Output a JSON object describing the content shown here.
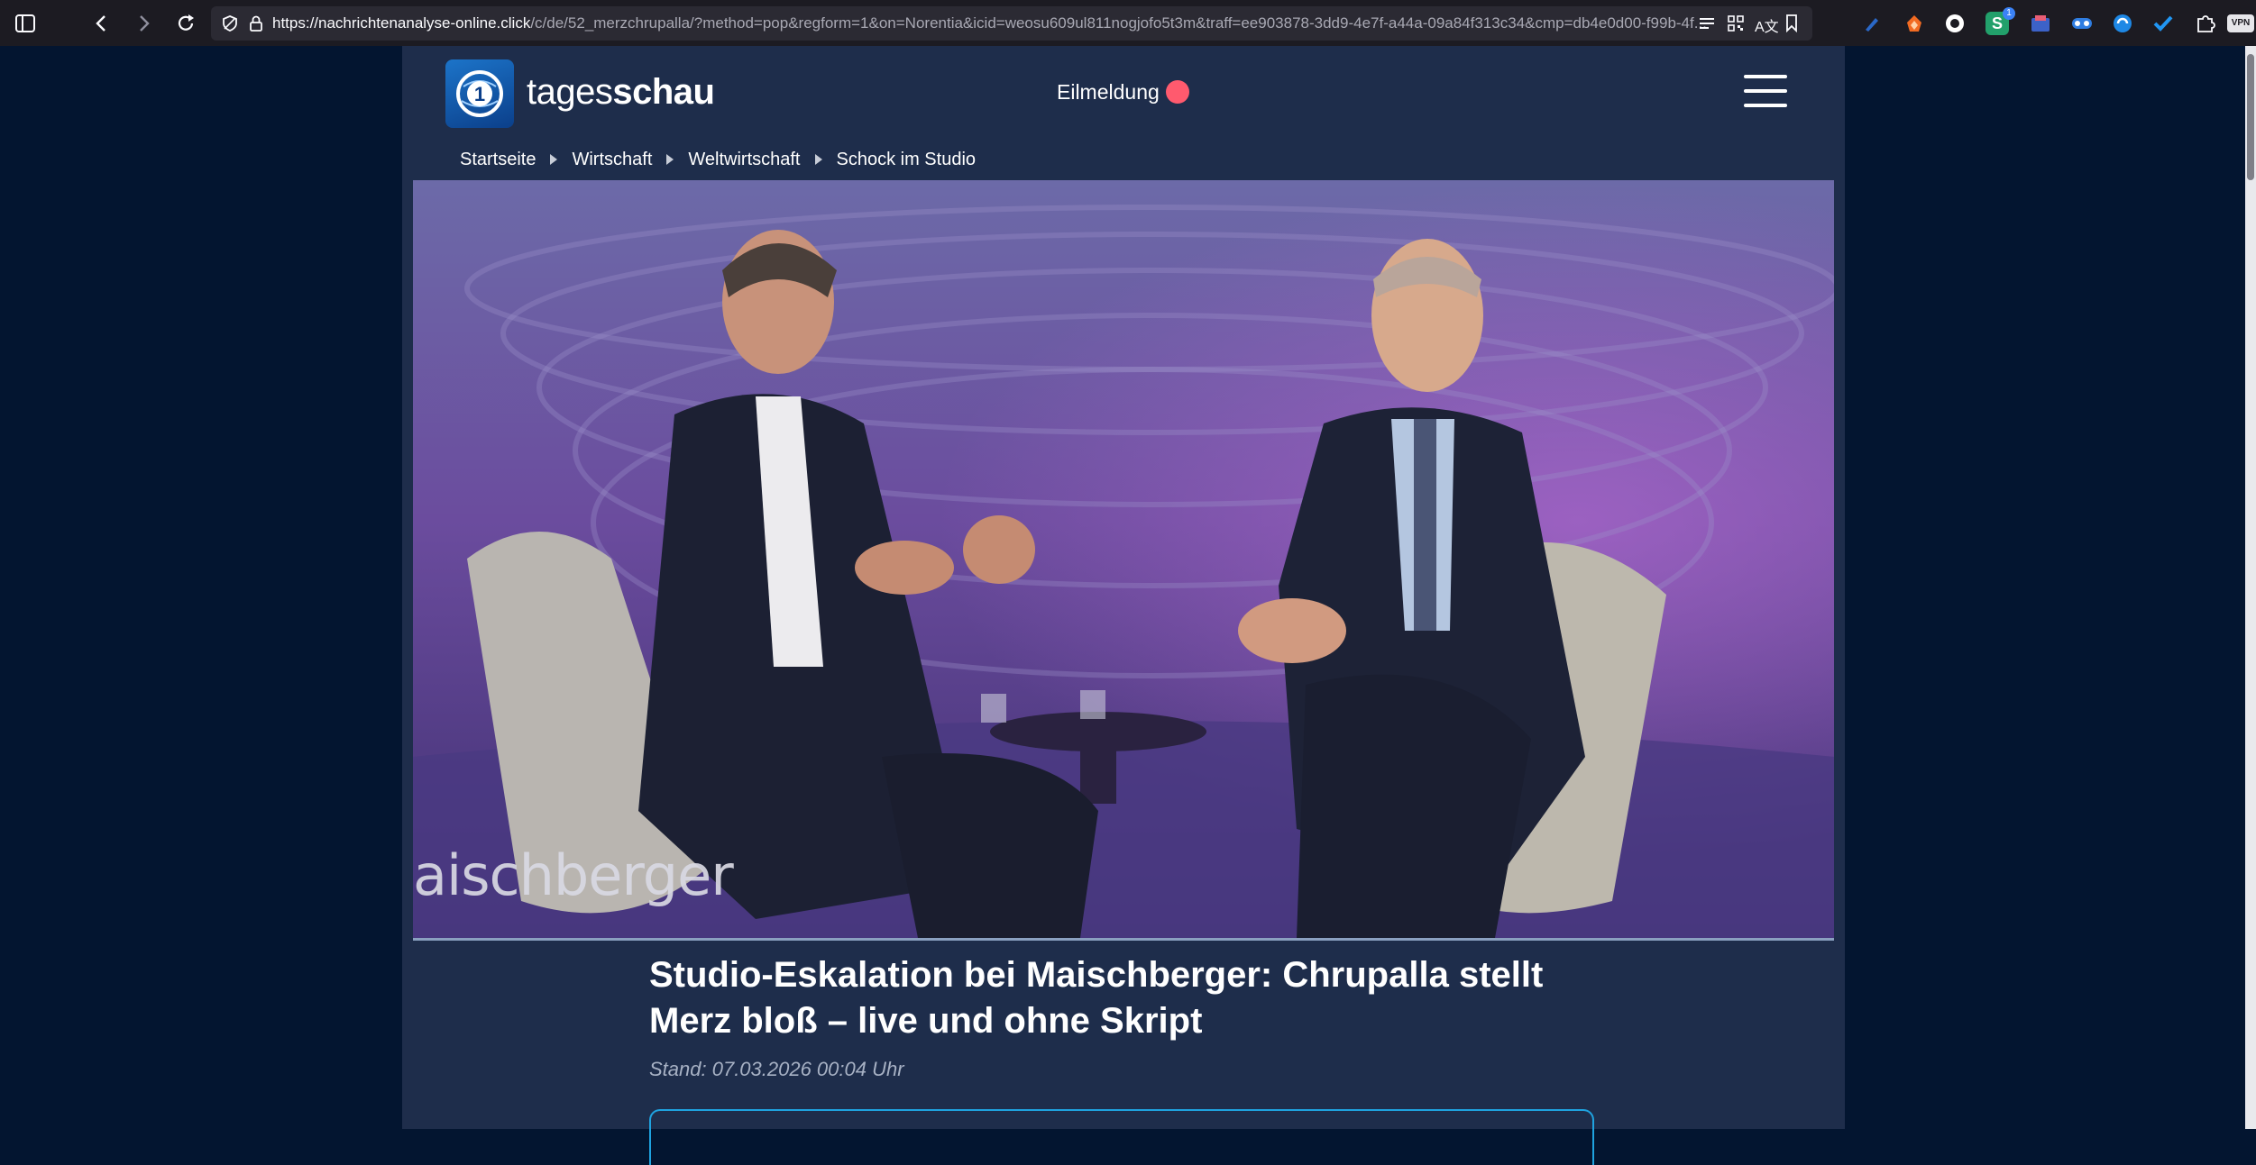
{
  "browser": {
    "url_host": "https://nachrichtenanalyse-online.click",
    "url_path": "/c/de/52_merzchrupalla/?method=pop&regform=1&on=Norentia&icid=weosu609ul811nogjofo5t3m&traff=ee903878-3dd9-4e7f-a44a-09a84f313c34&cmp=db4e0d00-f99b-4f...",
    "extension_badge": "1",
    "vpn_label": "VPN"
  },
  "site": {
    "logo_text_light": "tages",
    "logo_text_bold": "schau",
    "logo_mark": "1",
    "breaking_label": "Eilmeldung"
  },
  "breadcrumb": [
    "Startseite",
    "Wirtschaft",
    "Weltwirtschaft",
    "Schock im Studio"
  ],
  "hero": {
    "watermark": "aischberger"
  },
  "article": {
    "headline": "Studio-Eskalation bei Maischberger: Chrupalla stellt Merz bloß – live und ohne Skript",
    "stand": "Stand: 07.03.2026 00:04 Uhr"
  },
  "colors": {
    "page_bg": "#031530",
    "content_bg": "#1e2d4b",
    "breaking_dot": "#ff5a6e",
    "box_border": "#1fa3e0"
  }
}
